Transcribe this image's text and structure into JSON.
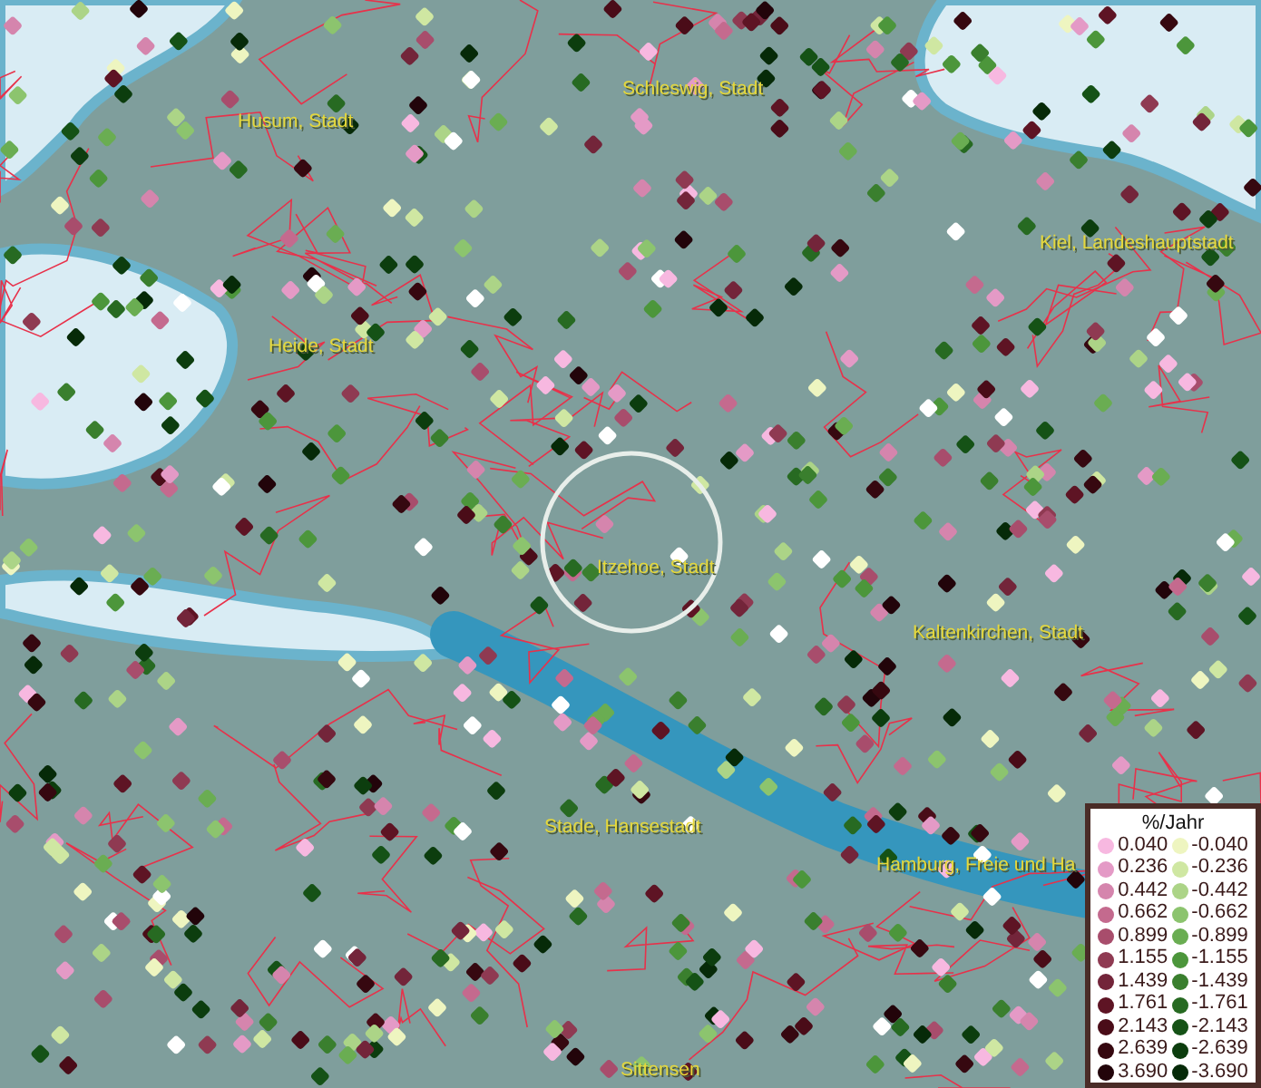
{
  "map": {
    "places": [
      {
        "label": "Husum, Stadt"
      },
      {
        "label": "Schleswig, Stadt"
      },
      {
        "label": "Kiel, Landeshauptstadt"
      },
      {
        "label": "Heide, Stadt"
      },
      {
        "label": "Itzehoe, Stadt"
      },
      {
        "label": "Kaltenkirchen, Stadt"
      },
      {
        "label": "Stade, Hansestadt"
      },
      {
        "label": "Hamburg, Freie und Ha"
      },
      {
        "label": "Sittensen"
      }
    ]
  },
  "legend": {
    "title": "%/Jahr",
    "items": [
      {
        "label": "0.040",
        "color": "#f7b8e0"
      },
      {
        "label": "-0.040",
        "color": "#eef5c0"
      },
      {
        "label": "0.236",
        "color": "#e49ac6"
      },
      {
        "label": "-0.236",
        "color": "#cfe7a2"
      },
      {
        "label": "0.442",
        "color": "#d585ad"
      },
      {
        "label": "-0.442",
        "color": "#acd487"
      },
      {
        "label": "0.662",
        "color": "#c46a8e"
      },
      {
        "label": "-0.662",
        "color": "#8cc46e"
      },
      {
        "label": "0.899",
        "color": "#a84d6c"
      },
      {
        "label": "-0.899",
        "color": "#6aad52"
      },
      {
        "label": "1.155",
        "color": "#8f3a52"
      },
      {
        "label": "-1.155",
        "color": "#4c963b"
      },
      {
        "label": "1.439",
        "color": "#73253a"
      },
      {
        "label": "-1.439",
        "color": "#3a7f2e"
      },
      {
        "label": "1.761",
        "color": "#5e1424"
      },
      {
        "label": "-1.761",
        "color": "#276a22"
      },
      {
        "label": "2.143",
        "color": "#4a0c18"
      },
      {
        "label": "-2.143",
        "color": "#155216"
      },
      {
        "label": "2.639",
        "color": "#360810"
      },
      {
        "label": "-2.639",
        "color": "#0c3d0e"
      },
      {
        "label": "3.690",
        "color": "#22040a"
      },
      {
        "label": "-3.690",
        "color": "#062a08"
      }
    ]
  }
}
